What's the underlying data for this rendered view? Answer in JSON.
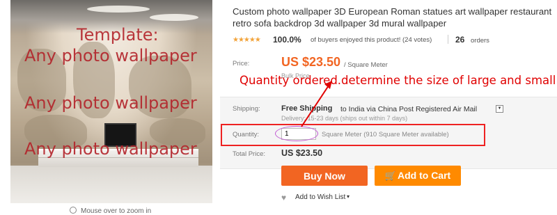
{
  "product": {
    "title": "Custom photo wallpaper 3D European Roman statues art wallpaper restaurant retro sofa backdrop 3d wallpaper 3d mural wallpaper",
    "stars": "★★★★★",
    "feedback_percent": "100.0%",
    "feedback_text": "of buyers enjoyed this product! (24 votes)",
    "orders_count": "26",
    "orders_label": "orders"
  },
  "image": {
    "watermark_lines": [
      "Template:",
      "Any photo wallpaper",
      "Any photo wallpaper",
      "Any photo wallpaper"
    ],
    "zoom_hint": "Mouse over to zoom in"
  },
  "price": {
    "label": "Price:",
    "value": "US $23.50",
    "unit": "/ Square Meter",
    "bulk": "Bulk Price"
  },
  "annotation": "Quantity ordered.determine the size of large and small",
  "shipping": {
    "label": "Shipping:",
    "free": "Free Shipping",
    "rest": "to India via China Post Registered Air Mail",
    "delivery": "Delivery: 15-23 days (ships out within 7 days)"
  },
  "quantity": {
    "label": "Quantity:",
    "value": "1",
    "unit_text": "Square Meter (910 Square Meter available)"
  },
  "total": {
    "label": "Total Price:",
    "value": "US $23.50"
  },
  "actions": {
    "buy_now": "Buy Now",
    "add_to_cart": "Add to Cart",
    "wishlist": "Add to Wish List"
  },
  "colors": {
    "price": "#f26522",
    "buy_button": "#f26522",
    "cart_button": "#ff8a00",
    "annotation": "#e00000",
    "stars": "#f2a33a"
  }
}
